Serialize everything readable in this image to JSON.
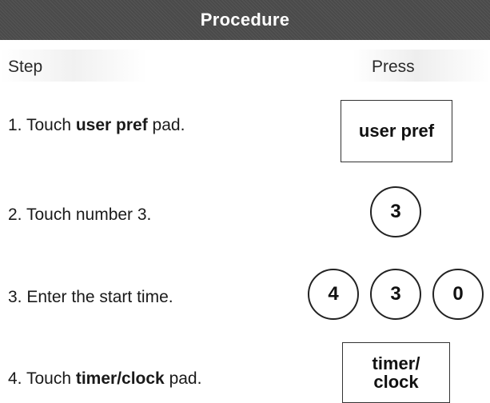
{
  "header": {
    "title": "Procedure"
  },
  "columns": {
    "step": "Step",
    "press": "Press"
  },
  "steps": [
    {
      "prefix": "1. Touch ",
      "bold": "user pref",
      "suffix": " pad.",
      "keys": [
        "user pref"
      ]
    },
    {
      "prefix": "2. Touch number 3.",
      "bold": "",
      "suffix": "",
      "keys": [
        "3"
      ]
    },
    {
      "prefix": "3. Enter the start time.",
      "bold": "",
      "suffix": "",
      "keys": [
        "4",
        "3",
        "0"
      ]
    },
    {
      "prefix": "4. Touch ",
      "bold": "timer/clock",
      "suffix": " pad.",
      "keys": [
        "timer/",
        "clock"
      ]
    }
  ]
}
